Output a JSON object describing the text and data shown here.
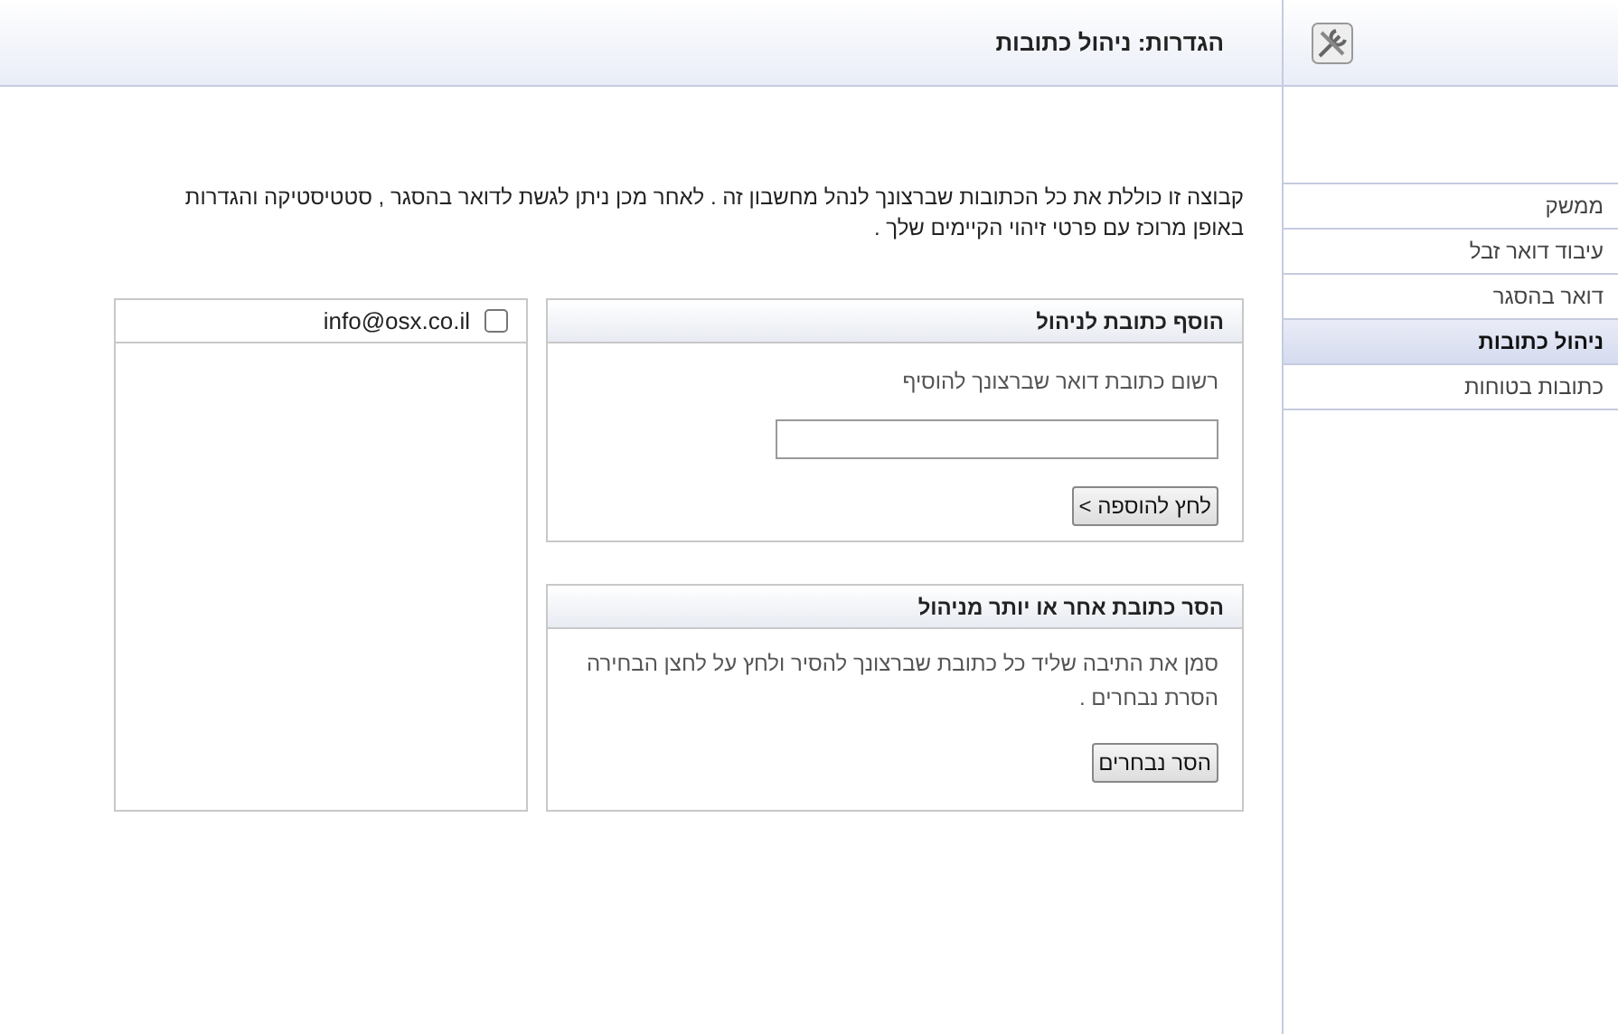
{
  "header": {
    "title": "הגדרות: ניהול כתובות"
  },
  "sidebar": {
    "items": [
      {
        "label": "ממשק",
        "selected": false
      },
      {
        "label": "עיבוד דואר זבל",
        "selected": false
      },
      {
        "label": "דואר בהסגר",
        "selected": false
      },
      {
        "label": "ניהול כתובות",
        "selected": true
      },
      {
        "label": "כתובות בטוחות",
        "selected": false
      }
    ]
  },
  "description": "קבוצה זו כוללת את כל הכתובות שברצונך לנהל מחשבון זה . לאחר מכן ניתן לגשת לדואר בהסגר , סטטיסטיקה והגדרות באופן מרוכז עם פרטי זיהוי הקיימים שלך .",
  "add_panel": {
    "title": "הוסף כתובת לניהול",
    "instruction": "רשום כתובת דואר שברצונך להוסיף",
    "button": "לחץ להוספה >"
  },
  "remove_panel": {
    "title": "הסר כתובת אחר או יותר מניהול",
    "instruction": "סמן את התיבה שליד כל כתובת שברצונך להסיר ולחץ על לחצן הבחירה הסרת נבחרים .",
    "button": "הסר נבחרים"
  },
  "addresses": [
    {
      "address": "info@osx.co.il",
      "checked": false
    }
  ]
}
